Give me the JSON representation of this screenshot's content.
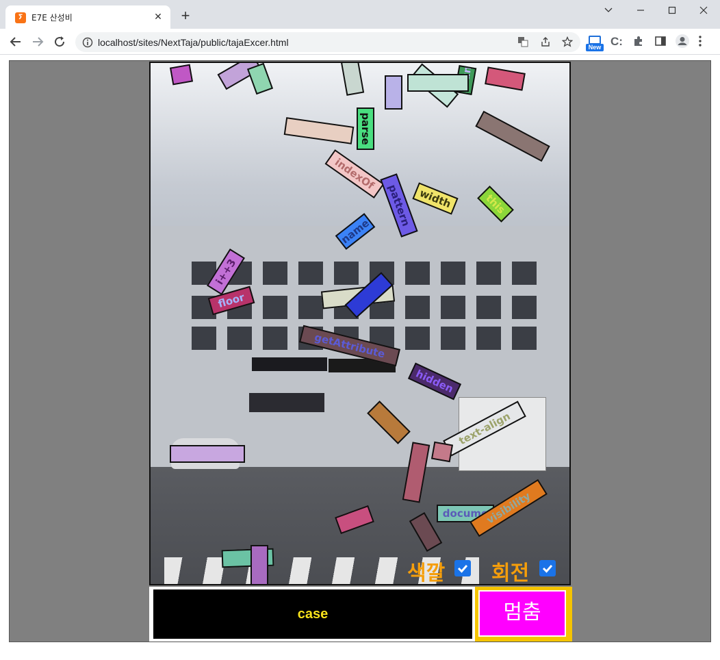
{
  "browser": {
    "tab_title": "E7E 산성비",
    "favicon_glyph": "ⵢ",
    "new_tab_icon": "+",
    "url": "localhost/sites/NextTaja/public/tajaExcer.html",
    "new_badge": "New",
    "extension_label": "C:"
  },
  "game": {
    "falling_words": [
      {
        "text": "parse",
        "bg": "#4ade80",
        "color": "#111"
      },
      {
        "text": "indexOf",
        "bg": "#f3c6c6",
        "color": "#b36b6b"
      },
      {
        "text": "pattern",
        "bg": "#6d5ae6",
        "color": "#2a1f7a"
      },
      {
        "text": "width",
        "bg": "#f0e46a",
        "color": "#3b3a10"
      },
      {
        "text": "this",
        "bg": "#8bd63a",
        "color": "#d4e84a"
      },
      {
        "text": "name",
        "bg": "#3b82f6",
        "color": "#1e3a8a"
      },
      {
        "text": "i++3",
        "bg": "#c270d6",
        "color": "#5b1e6b"
      },
      {
        "text": "floor",
        "bg": "#b8336a",
        "color": "#a5b4fc"
      },
      {
        "text": "getAttribute",
        "bg": "#6b4a52",
        "color": "#5b5bd6"
      },
      {
        "text": "hidden",
        "bg": "#4b2a6b",
        "color": "#8b5cf6"
      },
      {
        "text": "text-align",
        "bg": "#e5e7e9",
        "color": "#9ca36b"
      },
      {
        "text": "visibility",
        "bg": "#e07a1f",
        "color": "#8fa8a0"
      },
      {
        "text": "docume",
        "bg": "#7dc6b5",
        "color": "#5b5bb8"
      },
      {
        "text": "round",
        "bg": "#3f9a5a",
        "color": "#c4b5fd"
      }
    ],
    "toggles": [
      {
        "label": "색깔",
        "checked": true
      },
      {
        "label": "회전",
        "checked": true
      }
    ],
    "case_text": "case",
    "stop_button": "멈춤"
  }
}
